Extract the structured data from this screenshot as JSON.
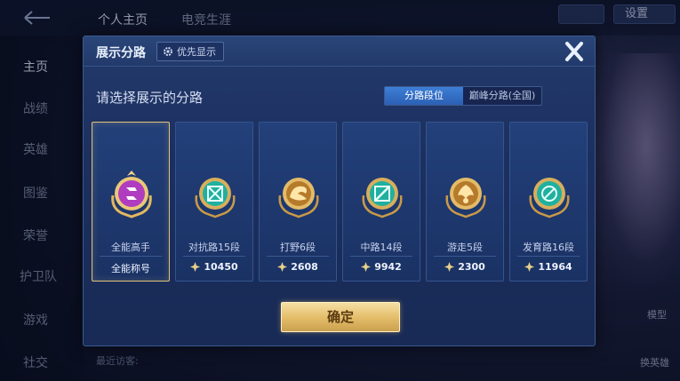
{
  "background": {
    "tabs": [
      "个人主页",
      "电竞生涯"
    ],
    "settings_label": "设置",
    "nav": [
      "主页",
      "战绩",
      "英雄",
      "图鉴",
      "荣誉",
      "护卫队",
      "游戏",
      "社交"
    ],
    "visitors_label": "最近访客:",
    "right_labels": [
      "模型",
      "换英雄"
    ]
  },
  "modal": {
    "title": "展示分路",
    "priority_label": "优先显示",
    "prompt": "请选择展示的分路",
    "toggle": [
      {
        "label": "分路段位",
        "active": true
      },
      {
        "label": "巅峰分路(全国)",
        "active": false
      }
    ],
    "cards": [
      {
        "label": "全能高手",
        "footer": "全能称号",
        "points": null,
        "selected": true,
        "emblem": "all-round-emblem-icon",
        "color": "#b03cc0"
      },
      {
        "label": "对抗路15段",
        "footer": null,
        "points": "10450",
        "selected": false,
        "emblem": "clash-lane-emblem-icon",
        "color": "#1fb0a0"
      },
      {
        "label": "打野6段",
        "footer": null,
        "points": "2608",
        "selected": false,
        "emblem": "jungle-emblem-icon",
        "color": "#c98a2e"
      },
      {
        "label": "中路14段",
        "footer": null,
        "points": "9942",
        "selected": false,
        "emblem": "mid-lane-emblem-icon",
        "color": "#1fb0a0"
      },
      {
        "label": "游走5段",
        "footer": null,
        "points": "2300",
        "selected": false,
        "emblem": "roam-emblem-icon",
        "color": "#c98a2e"
      },
      {
        "label": "发育路16段",
        "footer": null,
        "points": "11964",
        "selected": false,
        "emblem": "farm-lane-emblem-icon",
        "color": "#1fb0a0"
      }
    ],
    "confirm_label": "确定"
  },
  "colors": {
    "accent_blue": "#2b60b4",
    "gold": "#e5bf6c",
    "teal": "#1fb0a0",
    "purple": "#b03cc0"
  }
}
